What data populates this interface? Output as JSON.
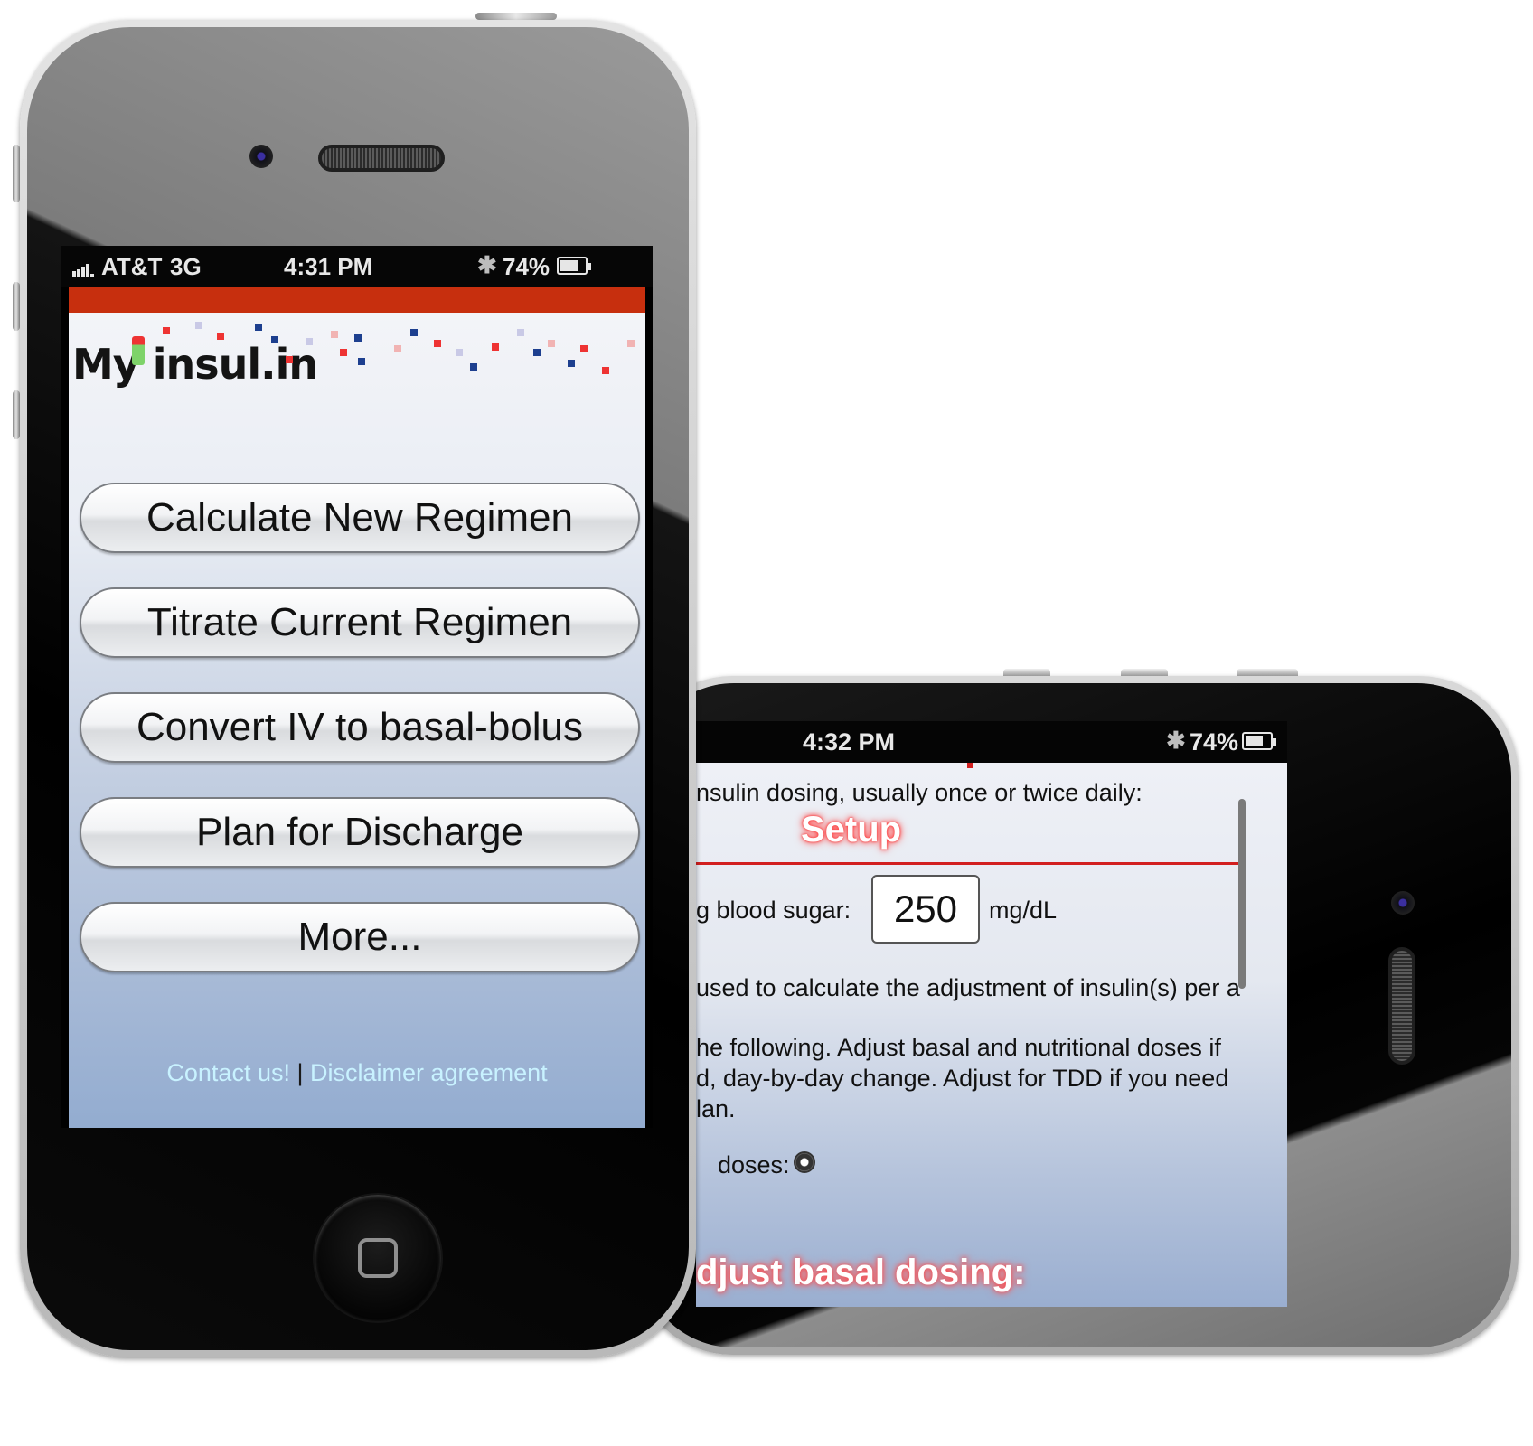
{
  "phone_main": {
    "status": {
      "carrier": "AT&T",
      "network": "3G",
      "time": "4:31 PM",
      "battery_percent": "74%",
      "battery_level": 0.74,
      "bluetooth_icon": "bluetooth-icon",
      "signal_icon": "signal-bars-icon"
    },
    "logo": "My insul.in",
    "menu": [
      {
        "label": "Calculate New Regimen"
      },
      {
        "label": "Titrate Current Regimen"
      },
      {
        "label": "Convert IV to basal-bolus"
      },
      {
        "label": "Plan for Discharge"
      },
      {
        "label": "More..."
      }
    ],
    "footer": {
      "contact": "Contact us!",
      "separator": "|",
      "disclaimer": "Disclaimer agreement"
    },
    "colors": {
      "accent_red": "#c72f0e",
      "link": "#c8f2ff"
    }
  },
  "phone_secondary": {
    "status": {
      "time": "4:32 PM",
      "battery_percent": "74%",
      "battery_level": 0.74,
      "bluetooth_icon": "bluetooth-icon"
    },
    "lines": {
      "dosing_note": "nsulin dosing, usually once or twice daily:",
      "setup_title": "Setup",
      "blood_sugar_label": "g blood sugar:",
      "blood_sugar_value": "250",
      "blood_sugar_unit": "mg/dL",
      "adjust_text": "used to calculate the adjustment of insulin(s) per a",
      "following_1": "he following. Adjust basal and nutritional doses if",
      "following_2": "d, day-by-day change. Adjust for TDD if you need",
      "following_3": "lan.",
      "doses_label": "doses:",
      "adjust_heading": "djust basal dosing:"
    }
  }
}
